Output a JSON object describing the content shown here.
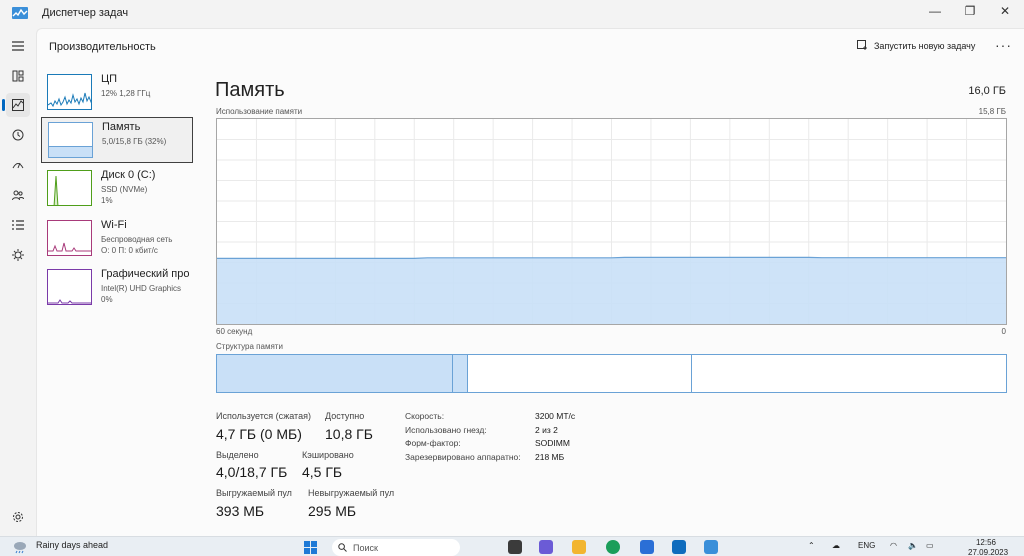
{
  "window": {
    "title": "Диспетчер задач",
    "controls": {
      "minimize": "—",
      "maximize": "❐",
      "close": "✕"
    }
  },
  "header": {
    "section_title": "Производительность",
    "run_task_label": "Запустить новую задачу",
    "more_label": "···"
  },
  "rail": {
    "items": [
      {
        "icon": "hamburger-icon"
      },
      {
        "icon": "processes-icon"
      },
      {
        "icon": "performance-icon",
        "active": true
      },
      {
        "icon": "app-history-icon"
      },
      {
        "icon": "startup-apps-icon"
      },
      {
        "icon": "users-icon"
      },
      {
        "icon": "details-icon"
      },
      {
        "icon": "services-icon"
      }
    ],
    "settings_icon": "gear-icon"
  },
  "devices": [
    {
      "name": "ЦП",
      "sub1": "12% 1,28 ГГц",
      "sub2": "",
      "sub3": ""
    },
    {
      "name": "Память",
      "sub1": "5,0/15,8 ГБ (32%)",
      "sub2": "",
      "sub3": ""
    },
    {
      "name": "Диск 0 (C:)",
      "sub1": "SSD (NVMe)",
      "sub2": "1%",
      "sub3": ""
    },
    {
      "name": "Wi-Fi",
      "sub1": "Беспроводная сеть",
      "sub2": "О: 0 П: 0 кбит/с",
      "sub3": ""
    },
    {
      "name": "Графический про",
      "sub1": "Intel(R) UHD Graphics",
      "sub2": "0%",
      "sub3": ""
    }
  ],
  "main": {
    "title": "Память",
    "total": "16,0 ГБ",
    "usage_label": "Использование памяти",
    "usage_max": "15,8 ГБ",
    "axis_left": "60 секунд",
    "axis_right": "0",
    "usage_fraction": 0.32,
    "structure_label": "Структура памяти",
    "structure": {
      "in_use": 4.7,
      "modified": 0.3,
      "standby": 4.5,
      "free": 6.3
    },
    "stats": {
      "in_use_label": "Используется (сжатая)",
      "in_use_value": "4,7 ГБ (0 МБ)",
      "available_label": "Доступно",
      "available_value": "10,8 ГБ",
      "committed_label": "Выделено",
      "committed_value": "4,0/18,7 ГБ",
      "cached_label": "Кэшировано",
      "cached_value": "4,5 ГБ",
      "paged_label": "Выгружаемый пул",
      "paged_value": "393 МБ",
      "nonpaged_label": "Невыгружаемый пул",
      "nonpaged_value": "295 МБ"
    },
    "props": [
      {
        "label": "Скорость:",
        "value": "3200 MT/c"
      },
      {
        "label": "Использовано гнезд:",
        "value": "2 из 2"
      },
      {
        "label": "Форм-фактор:",
        "value": "SODIMM"
      },
      {
        "label": "Зарезервировано аппаратно:",
        "value": "218 МБ"
      }
    ]
  },
  "taskbar": {
    "weather": "Rainy days ahead",
    "search_placeholder": "Поиск",
    "lang": "ENG",
    "time": "12:56",
    "date": "27.09.2023"
  },
  "colors": {
    "accent": "#0067c0",
    "memory_fill": "#c9e0f7",
    "memory_line": "#6aa2d6",
    "cpu": "#1a7ab8",
    "disk": "#4f9e1a",
    "wifi": "#a83a7a",
    "gpu": "#7a3aa8"
  }
}
